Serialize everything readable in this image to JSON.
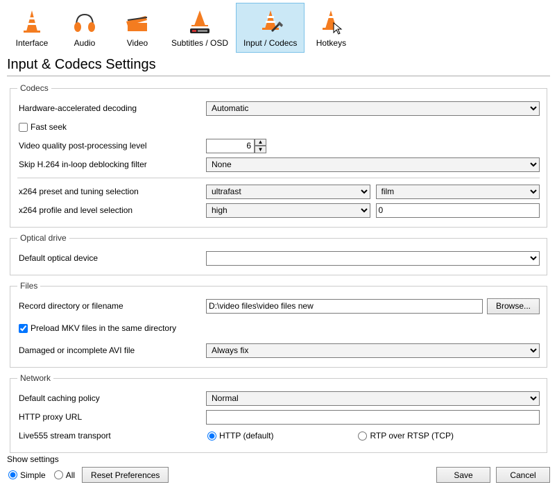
{
  "tabs": {
    "interface": {
      "label": "Interface"
    },
    "audio": {
      "label": "Audio"
    },
    "video": {
      "label": "Video"
    },
    "subtitles": {
      "label": "Subtitles / OSD"
    },
    "inputcodecs": {
      "label": "Input / Codecs"
    },
    "hotkeys": {
      "label": "Hotkeys"
    }
  },
  "page_title": "Input & Codecs Settings",
  "codecs": {
    "legend": "Codecs",
    "hwdec_label": "Hardware-accelerated decoding",
    "hwdec_value": "Automatic",
    "fastseek_label": "Fast seek",
    "fastseek_checked": false,
    "pplevel_label": "Video quality post-processing level",
    "pplevel_value": "6",
    "skipdeblock_label": "Skip H.264 in-loop deblocking filter",
    "skipdeblock_value": "None",
    "x264preset_label": "x264 preset and tuning selection",
    "x264preset_value": "ultrafast",
    "x264tune_value": "film",
    "x264profile_label": "x264 profile and level selection",
    "x264profile_value": "high",
    "x264level_value": "0"
  },
  "optical": {
    "legend": "Optical drive",
    "device_label": "Default optical device",
    "device_value": ""
  },
  "files": {
    "legend": "Files",
    "recdir_label": "Record directory or filename",
    "recdir_value": "D:\\video files\\video files new",
    "browse_label": "Browse...",
    "preload_label": "Preload MKV files in the same directory",
    "preload_checked": true,
    "avi_label": "Damaged or incomplete AVI file",
    "avi_value": "Always fix"
  },
  "network": {
    "legend": "Network",
    "cache_label": "Default caching policy",
    "cache_value": "Normal",
    "proxy_label": "HTTP proxy URL",
    "proxy_value": "",
    "live555_label": "Live555 stream transport",
    "live555_http": "HTTP (default)",
    "live555_rtp": "RTP over RTSP (TCP)"
  },
  "footer": {
    "show_settings": "Show settings",
    "simple": "Simple",
    "all": "All",
    "reset": "Reset Preferences",
    "save": "Save",
    "cancel": "Cancel"
  }
}
